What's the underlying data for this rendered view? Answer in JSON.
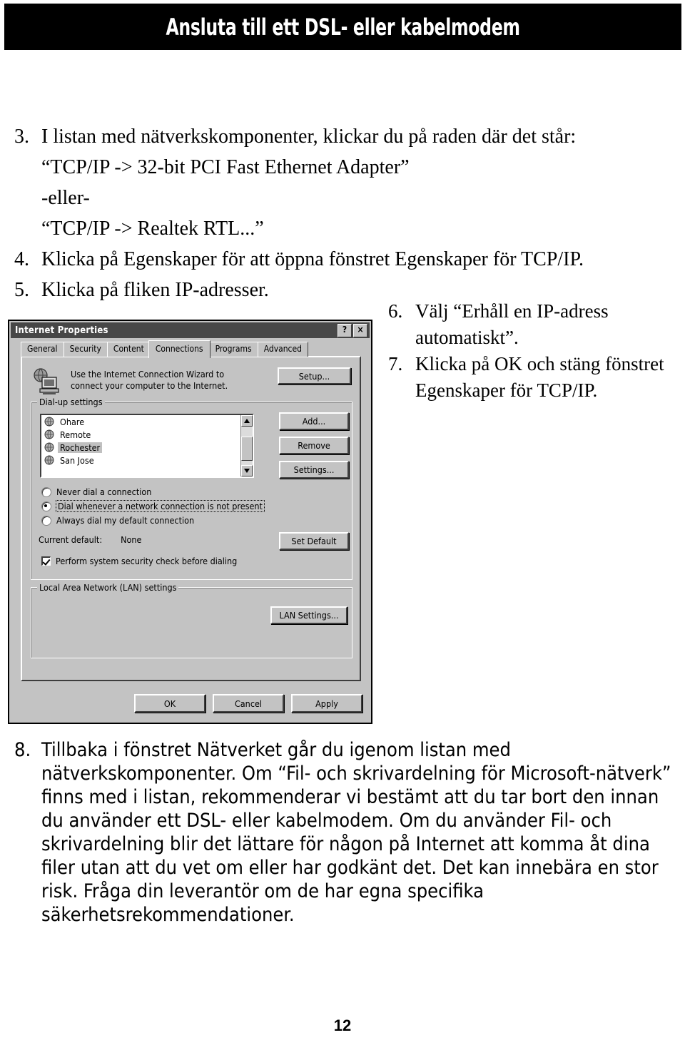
{
  "header": {
    "title": "Ansluta till ett DSL- eller kabelmodem"
  },
  "page_number": "12",
  "steps_top": [
    {
      "number": "3.",
      "text": "I listan med nätverkskomponenter, klickar du på raden där det står:",
      "sublines": [
        "“TCP/IP -> 32-bit PCI Fast Ethernet Adapter”",
        "-eller-",
        "“TCP/IP -> Realtek RTL...”"
      ]
    },
    {
      "number": "4.",
      "text": "Klicka på Egenskaper för att öppna fönstret Egenskaper för TCP/IP.",
      "sublines": []
    },
    {
      "number": "5.",
      "text": "Klicka på fliken IP-adresser.",
      "sublines": []
    }
  ],
  "steps_right": [
    {
      "number": "6.",
      "text": "Välj “Erhåll en IP-adress automatiskt”."
    },
    {
      "number": "7.",
      "text": "Klicka på OK och stäng fönstret Egenskaper för TCP/IP."
    }
  ],
  "steps_bottom": [
    {
      "number": "8.",
      "text": "Tillbaka i fönstret Nätverket går du igenom listan med nätverkskomponenter. Om “Fil- och skrivardelning för Microsoft-nätverk” finns med i listan, rekommenderar vi bestämt att du tar bort den innan du använder ett DSL- eller kabelmodem. Om du använder Fil- och skrivardelning blir det lättare för någon på Internet att komma åt dina filer utan att du vet om eller har godkänt det. Det kan innebära en stor risk. Fråga din leverantör om de har egna specifika säkerhetsrekommendationer."
    }
  ],
  "dialog": {
    "title": "Internet Properties",
    "titlebar_buttons": [
      {
        "name": "help-button",
        "label": "?"
      },
      {
        "name": "close-button",
        "label": "×"
      }
    ],
    "tabs": [
      {
        "label": "General",
        "active": false
      },
      {
        "label": "Security",
        "active": false
      },
      {
        "label": "Content",
        "active": false
      },
      {
        "label": "Connections",
        "active": true
      },
      {
        "label": "Programs",
        "active": false
      },
      {
        "label": "Advanced",
        "active": false
      }
    ],
    "wizard": {
      "line1": "Use the Internet Connection Wizard to",
      "line2": "connect your computer to the Internet.",
      "setup_button": "Setup..."
    },
    "dialup": {
      "group_label": "Dial-up settings",
      "connections": [
        {
          "label": "Ohare",
          "selected": false
        },
        {
          "label": "Remote",
          "selected": false
        },
        {
          "label": "Rochester",
          "selected": true
        },
        {
          "label": "San Jose",
          "selected": false
        }
      ],
      "buttons": {
        "add": "Add...",
        "remove": "Remove",
        "settings": "Settings...",
        "set_default": "Set Default"
      },
      "radios": [
        {
          "label": "Never dial a connection",
          "checked": false,
          "focused": false
        },
        {
          "label": "Dial whenever a network connection is not present",
          "checked": true,
          "focused": true
        },
        {
          "label": "Always dial my default connection",
          "checked": false,
          "focused": false
        }
      ],
      "current_default_label": "Current default:",
      "current_default_value": "None",
      "checkbox": {
        "label": "Perform system security check before dialing",
        "checked": true
      }
    },
    "lan": {
      "group_label": "Local Area Network (LAN) settings",
      "button": "LAN Settings..."
    },
    "footer_buttons": [
      {
        "name": "ok-button",
        "label": "OK"
      },
      {
        "name": "cancel-button",
        "label": "Cancel"
      },
      {
        "name": "apply-button",
        "label": "Apply"
      }
    ]
  },
  "colors": {
    "header_bg": "#000000",
    "header_fg": "#ffffff",
    "dialog_face": "#c0c0c0",
    "titlebar_bg": "#4a4a4a",
    "listbox_bg": "#ffffff",
    "selection_bg": "#bdbdbd",
    "page_bg": "#ffffff"
  }
}
